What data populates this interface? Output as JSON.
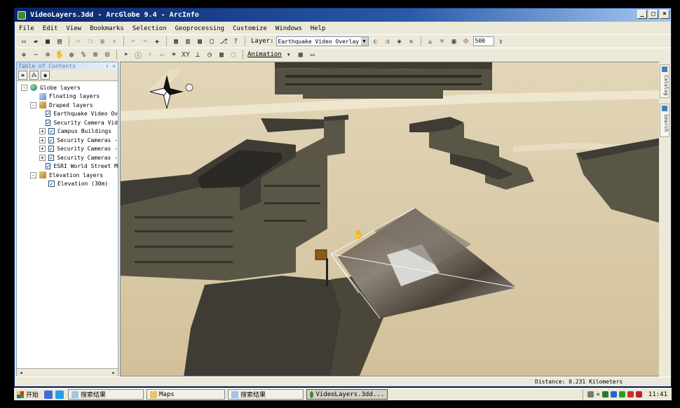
{
  "window": {
    "title": "VideoLayers.3dd - ArcGlobe 9.4 - ArcInfo"
  },
  "window_controls": [
    "_",
    "□",
    "×"
  ],
  "menu": [
    "File",
    "Edit",
    "View",
    "Bookmarks",
    "Selection",
    "Geoprocessing",
    "Customize",
    "Windows",
    "Help"
  ],
  "toolbar": {
    "layer_label": "Layer:",
    "layer_value": "Earthquake Video Overlay",
    "zoom_value": "500",
    "animation_label": "Animation"
  },
  "toc": {
    "title": "Table of Contents",
    "pin": "↑ ×",
    "items": [
      {
        "label": "Globe layers",
        "expander": "-",
        "checked": null,
        "icon": "globe-icon",
        "indent": 0
      },
      {
        "label": "Floating layers",
        "expander": "",
        "checked": null,
        "icon": "floating-layers-icon",
        "indent": 1
      },
      {
        "label": "Draped layers",
        "expander": "-",
        "checked": null,
        "icon": "draped-layers-icon",
        "indent": 1
      },
      {
        "label": "Earthquake Video Ov",
        "expander": "",
        "checked": true,
        "icon": "",
        "indent": 2
      },
      {
        "label": "Security Camera Vid",
        "expander": "",
        "checked": true,
        "icon": "",
        "indent": 2
      },
      {
        "label": "Campus Buildings",
        "expander": "+",
        "checked": true,
        "icon": "",
        "indent": 2
      },
      {
        "label": "Security Cameras -",
        "expander": "+",
        "checked": true,
        "icon": "",
        "indent": 2
      },
      {
        "label": "Security Cameras -",
        "expander": "+",
        "checked": true,
        "icon": "",
        "indent": 2
      },
      {
        "label": "Security Cameras -",
        "expander": "+",
        "checked": true,
        "icon": "",
        "indent": 2
      },
      {
        "label": "ESRI World Street M",
        "expander": "",
        "checked": true,
        "icon": "",
        "indent": 2
      },
      {
        "label": "Elevation layers",
        "expander": "-",
        "checked": null,
        "icon": "elevation-layers-icon",
        "indent": 1
      },
      {
        "label": "Elevation (30m)",
        "expander": "",
        "checked": true,
        "icon": "",
        "indent": 2
      }
    ]
  },
  "dock": {
    "catalog": "Catalog",
    "search": "Search"
  },
  "status": {
    "distance": "Distance:  0.231 Kilometers"
  },
  "taskbar": {
    "start": "开始",
    "tasks": [
      {
        "label": "搜索结果",
        "active": false
      },
      {
        "label": "Maps",
        "active": false
      },
      {
        "label": "搜索结果",
        "active": false
      },
      {
        "label": "VideoLayers.3dd...",
        "active": true
      }
    ],
    "tray_arrow": "«",
    "clock": "11:41"
  },
  "colors": {
    "title_start": "#0a246a",
    "title_end": "#a6caf0",
    "chrome": "#ece9d8",
    "ground": "#d8c8a6",
    "building_roof": "#3e3c34",
    "building_wall": "#5a5646"
  }
}
